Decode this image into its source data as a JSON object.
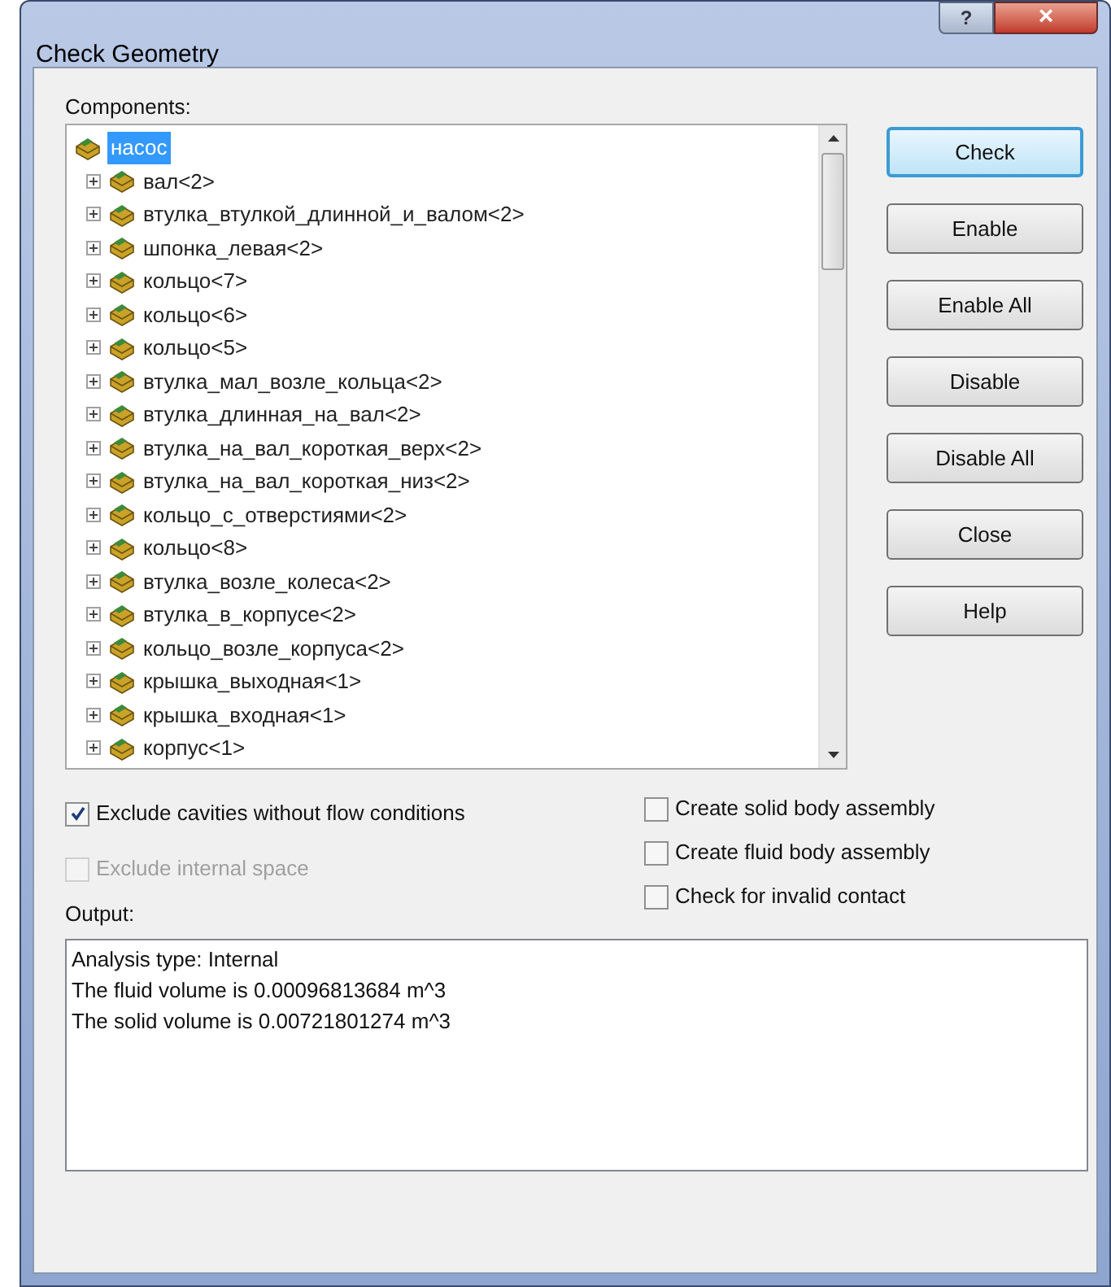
{
  "window": {
    "title": "Check Geometry",
    "help_button": "?",
    "close_button": "×"
  },
  "components": {
    "label": "Components:",
    "root": {
      "label": "насос",
      "selected": true,
      "children": [
        {
          "label": "вал<2>",
          "expanded": false
        },
        {
          "label": "втулка_втулкой_длинной_и_валом<2>",
          "expanded": false
        },
        {
          "label": "шпонка_левая<2>",
          "expanded": false
        },
        {
          "label": "кольцо<7>",
          "expanded": false
        },
        {
          "label": "кольцо<6>",
          "expanded": false
        },
        {
          "label": "кольцо<5>",
          "expanded": false
        },
        {
          "label": "втулка_мал_возле_кольца<2>",
          "expanded": false
        },
        {
          "label": "втулка_длинная_на_вал<2>",
          "expanded": false
        },
        {
          "label": "втулка_на_вал_короткая_верх<2>",
          "expanded": false
        },
        {
          "label": "втулка_на_вал_короткая_низ<2>",
          "expanded": false
        },
        {
          "label": "кольцо_с_отверстиями<2>",
          "expanded": false
        },
        {
          "label": "кольцо<8>",
          "expanded": false
        },
        {
          "label": "втулка_возле_колеса<2>",
          "expanded": false
        },
        {
          "label": "втулка_в_корпусе<2>",
          "expanded": false
        },
        {
          "label": "кольцо_возле_корпуса<2>",
          "expanded": false
        },
        {
          "label": "крышка_выходная<1>",
          "expanded": false
        },
        {
          "label": "крышка_входная<1>",
          "expanded": false
        },
        {
          "label": "корпус<1>",
          "expanded": false
        }
      ]
    }
  },
  "buttons": [
    {
      "label": "Check",
      "default": true
    },
    {
      "label": "Enable",
      "default": false
    },
    {
      "label": "Enable All",
      "default": false
    },
    {
      "label": "Disable",
      "default": false
    },
    {
      "label": "Disable All",
      "default": false
    },
    {
      "label": "Close",
      "default": false
    },
    {
      "label": "Help",
      "default": false
    }
  ],
  "options_left": [
    {
      "label": "Exclude cavities without flow conditions",
      "checked": true,
      "disabled": false
    },
    {
      "label": "Exclude internal space",
      "checked": false,
      "disabled": true
    }
  ],
  "options_right": [
    {
      "label": "Create solid body assembly",
      "checked": false,
      "disabled": false
    },
    {
      "label": "Create fluid body assembly",
      "checked": false,
      "disabled": false
    },
    {
      "label": "Check for invalid contact",
      "checked": false,
      "disabled": false
    }
  ],
  "output": {
    "label": "Output:",
    "lines": [
      "Analysis type: Internal",
      "The fluid volume is 0.00096813684 m^3",
      "The solid volume is 0.00721801274 m^3"
    ]
  }
}
